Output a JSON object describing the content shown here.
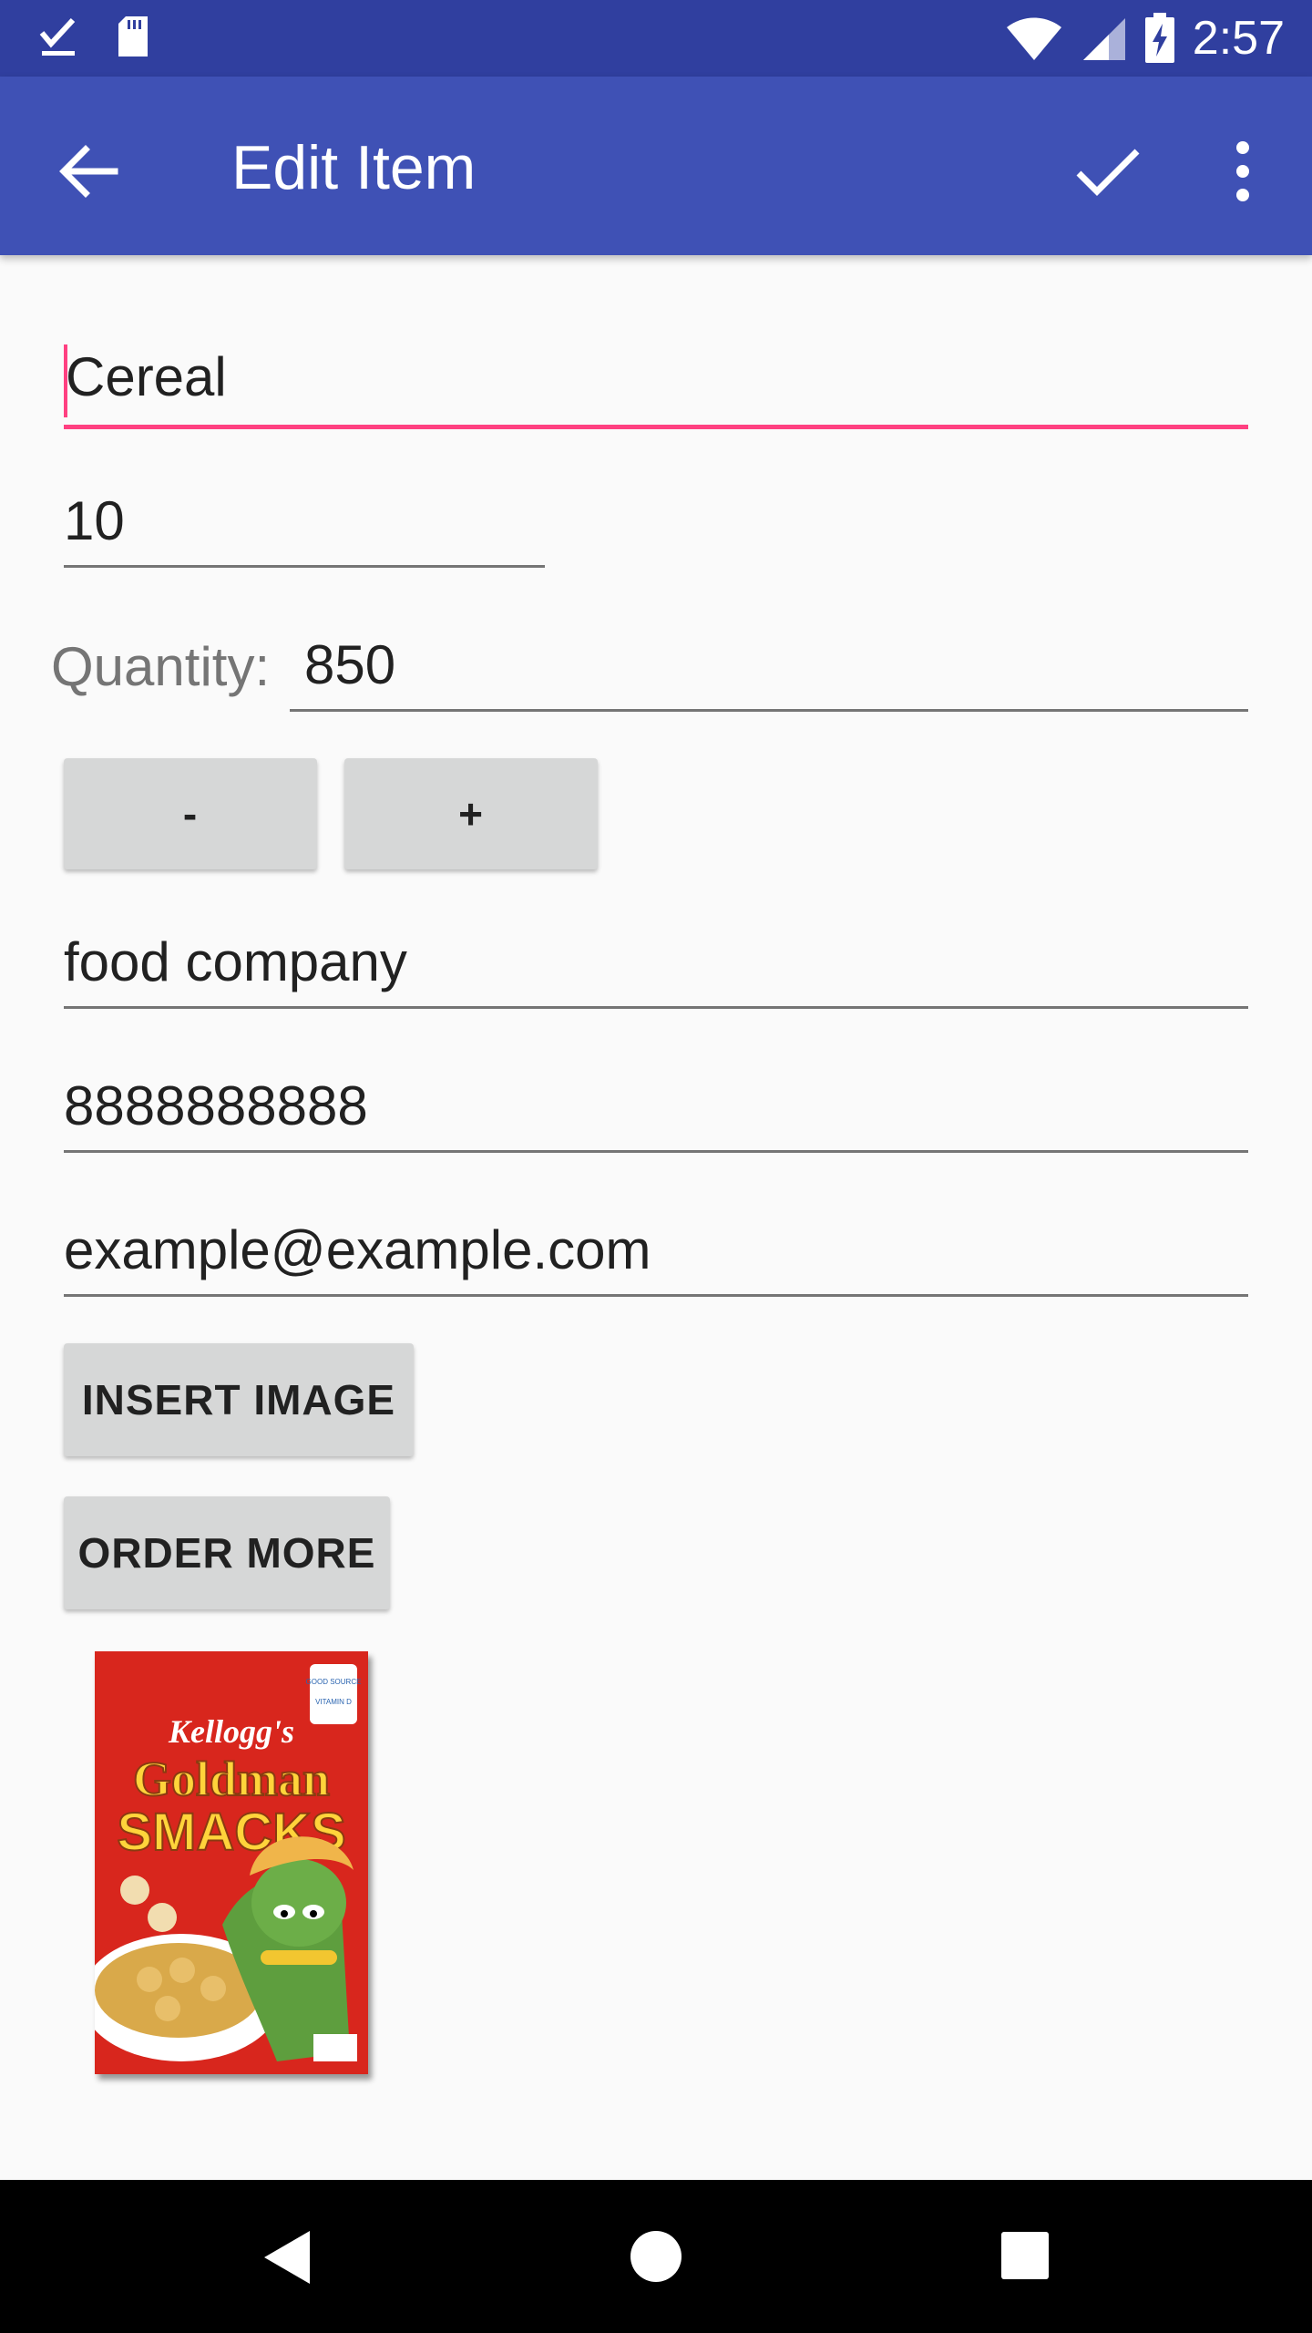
{
  "status_bar": {
    "time": "2:57",
    "icons": [
      "check-icon",
      "sd-card-icon",
      "wifi-icon",
      "signal-icon",
      "battery-icon"
    ]
  },
  "app_bar": {
    "title": "Edit Item",
    "icons": [
      "back-arrow-icon",
      "check-icon",
      "more-vert-icon"
    ],
    "color": "#3f51b5",
    "status_color": "#303f9f"
  },
  "form": {
    "name": "Cereal",
    "price": "10",
    "quantity_label": "Quantity:",
    "quantity": "850",
    "decrement_label": "-",
    "increment_label": "+",
    "supplier": "food company",
    "phone": "8888888888",
    "email": "example@example.com",
    "insert_image_label": "INSERT IMAGE",
    "order_more_label": "ORDER MORE",
    "accent_color": "#ff4081"
  },
  "product_image": {
    "brand": "Kellogg's",
    "title_line1": "Goldman",
    "title_line2": "SMACKS",
    "badge_line1": "GOOD SOURCE",
    "badge_line2": "VITAMIN D"
  },
  "nav_bar": {
    "icons": [
      "back-triangle-icon",
      "home-circle-icon",
      "recents-square-icon"
    ]
  }
}
